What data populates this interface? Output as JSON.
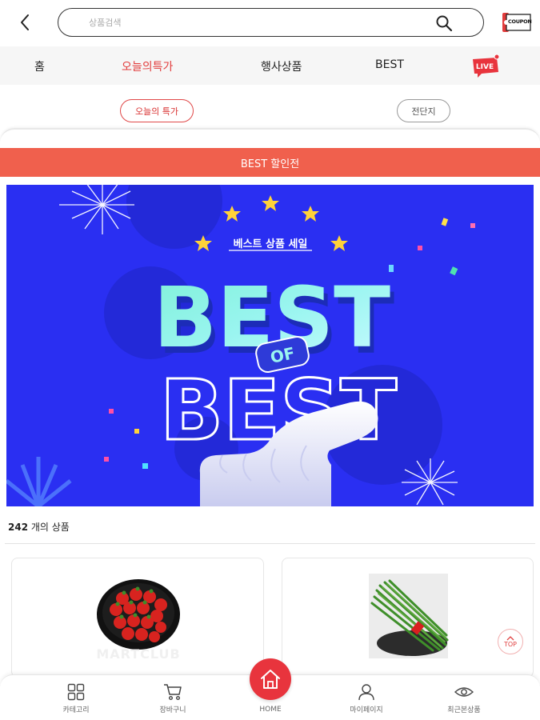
{
  "header": {
    "search_placeholder": "상품검색",
    "coupon_label": "COUPON"
  },
  "nav": {
    "items": [
      {
        "label": "홈"
      },
      {
        "label": "오늘의특가"
      },
      {
        "label": "행사상품"
      },
      {
        "label": "BEST"
      }
    ],
    "active_index": 1,
    "live_label": "LIVE"
  },
  "subtabs": {
    "active_label": "오늘의 특가",
    "other_label": "전단지"
  },
  "banner": {
    "title": "BEST 할인전"
  },
  "promo": {
    "subtitle": "베스트 상품 세일",
    "headline_top": "BEST",
    "badge": "OF",
    "headline_bottom": "BEST",
    "background_color": "#2a2ff2"
  },
  "products": {
    "count": "242",
    "count_suffix": " 개의 상품",
    "items": [
      {
        "watermark": "MARTCLUB",
        "image": "strawberry-tray"
      },
      {
        "watermark": "",
        "image": "chives-bundle"
      }
    ]
  },
  "top_button": {
    "label": "TOP"
  },
  "bottom_nav": {
    "items": [
      {
        "label": "카테고리",
        "icon": "grid-icon"
      },
      {
        "label": "장바구니",
        "icon": "cart-icon"
      },
      {
        "label": "HOME",
        "icon": "home-icon"
      },
      {
        "label": "마이페이지",
        "icon": "person-icon"
      },
      {
        "label": "최근본상품",
        "icon": "eye-icon"
      }
    ]
  },
  "colors": {
    "accent": "#e23b3b",
    "banner": "#f0604d",
    "home_button": "#e8343d"
  }
}
